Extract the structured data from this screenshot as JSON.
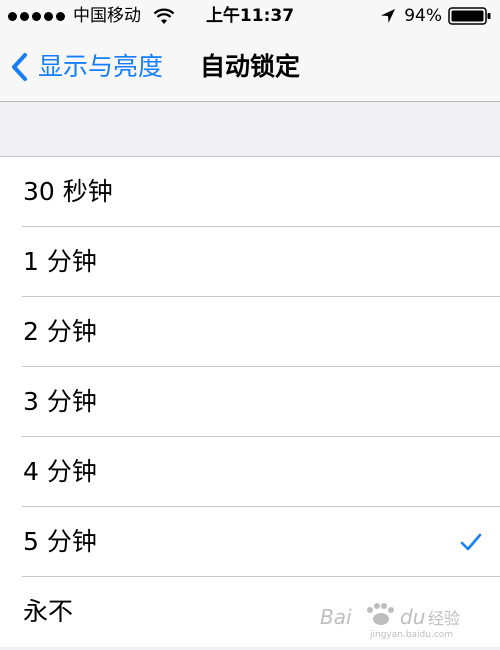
{
  "status_bar": {
    "carrier": "中国移动",
    "time": "上午11:37",
    "battery_percent": "94%",
    "signal_dots": 5,
    "icons": [
      "wifi-icon",
      "location-icon",
      "battery-icon"
    ]
  },
  "nav": {
    "back_label": "显示与亮度",
    "title": "自动锁定",
    "back_icon": "chevron-left-icon"
  },
  "options": [
    {
      "label": "30 秒钟",
      "selected": false
    },
    {
      "label": "1 分钟",
      "selected": false
    },
    {
      "label": "2 分钟",
      "selected": false
    },
    {
      "label": "3 分钟",
      "selected": false
    },
    {
      "label": "4 分钟",
      "selected": false
    },
    {
      "label": "5 分钟",
      "selected": true
    },
    {
      "label": "永不",
      "selected": false
    }
  ],
  "colors": {
    "accent": "#157efb",
    "background": "#efeff4",
    "separator": "#c8c7cc"
  },
  "watermark": {
    "text": "Baidu经验",
    "subtext": "jingyan.baidu.com"
  }
}
